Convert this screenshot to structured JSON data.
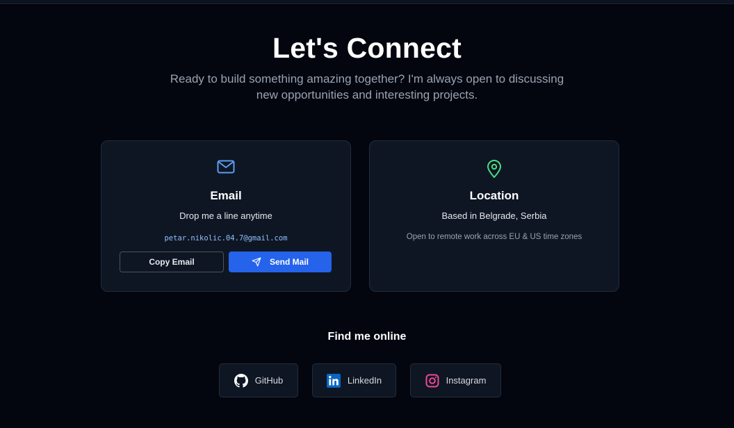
{
  "header": {
    "title": "Let's Connect",
    "subtitle_line1": "Ready to build something amazing together? I'm always open to discussing",
    "subtitle_line2": "new opportunities and interesting projects."
  },
  "email_card": {
    "icon": "mail-icon",
    "title": "Email",
    "description": "Drop me a line anytime",
    "address": "petar.nikolic.04.7@gmail.com",
    "copy_label": "Copy Email",
    "send_label": "Send Mail"
  },
  "location_card": {
    "icon": "map-pin-icon",
    "title": "Location",
    "description": "Based in Belgrade, Serbia",
    "note": "Open to remote work across EU & US time zones"
  },
  "social": {
    "heading": "Find me online",
    "links": [
      {
        "label": "GitHub",
        "icon": "github-icon"
      },
      {
        "label": "LinkedIn",
        "icon": "linkedin-icon"
      },
      {
        "label": "Instagram",
        "icon": "instagram-icon"
      }
    ]
  },
  "colors": {
    "background": "#03060f",
    "card": "#0f1623",
    "accent_blue": "#2563eb",
    "mail_icon": "#5b9ef5",
    "pin_icon": "#4ade80",
    "linkedin": "#0a66c2",
    "instagram": "#ec4899"
  }
}
